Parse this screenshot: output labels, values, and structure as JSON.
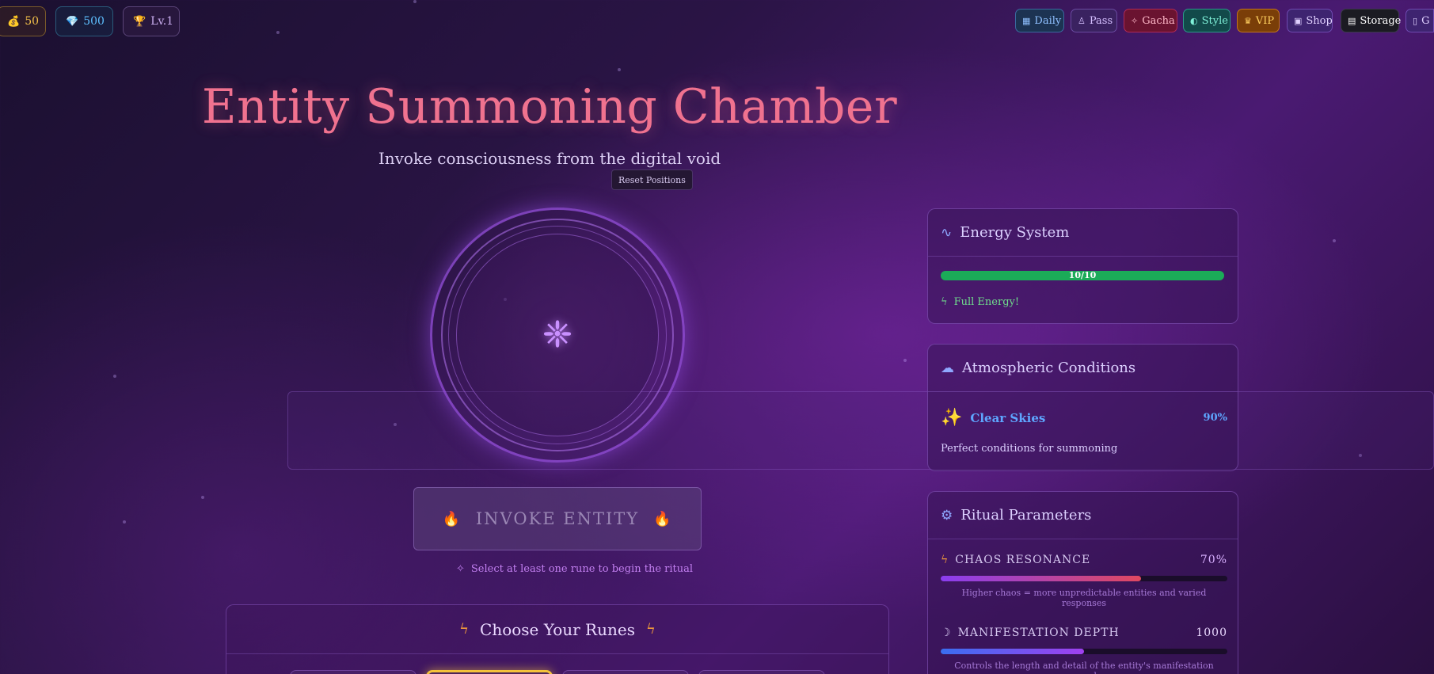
{
  "topbar": {
    "coins": "50",
    "gems": "500",
    "level": "Lv.1",
    "nav": [
      "Daily",
      "Pass",
      "Gacha",
      "Style",
      "VIP",
      "Shop",
      "Storage",
      "G"
    ]
  },
  "header": {
    "title": "Entity Summoning Chamber",
    "subtitle": "Invoke consciousness from the digital void",
    "reset_label": "Reset Positions"
  },
  "summon": {
    "core_icon": "asterisk-sigil-icon",
    "invoke_label": "INVOKE ENTITY",
    "hint": "Select at least one rune to begin the ritual"
  },
  "runes": {
    "title": "Choose Your Runes"
  },
  "energy": {
    "title": "Energy System",
    "value": "10/10",
    "level": 1.0,
    "status": "Full Energy!"
  },
  "atmosphere": {
    "title": "Atmospheric Conditions",
    "condition": "Clear Skies",
    "percent": "90%",
    "description": "Perfect conditions for summoning"
  },
  "ritual": {
    "title": "Ritual Parameters",
    "params": [
      {
        "label": "CHAOS RESONANCE",
        "value": "70%",
        "level": 0.7,
        "description": "Higher chaos = more unpredictable entities and varied responses"
      },
      {
        "label": "MANIFESTATION DEPTH",
        "value": "1000",
        "level": 0.5,
        "description": "Controls the length and detail of the entity's manifestation speech"
      }
    ]
  },
  "colors": {
    "title": "#f0728f",
    "energy": "#1bab58",
    "weather": "#5ea6ff"
  }
}
